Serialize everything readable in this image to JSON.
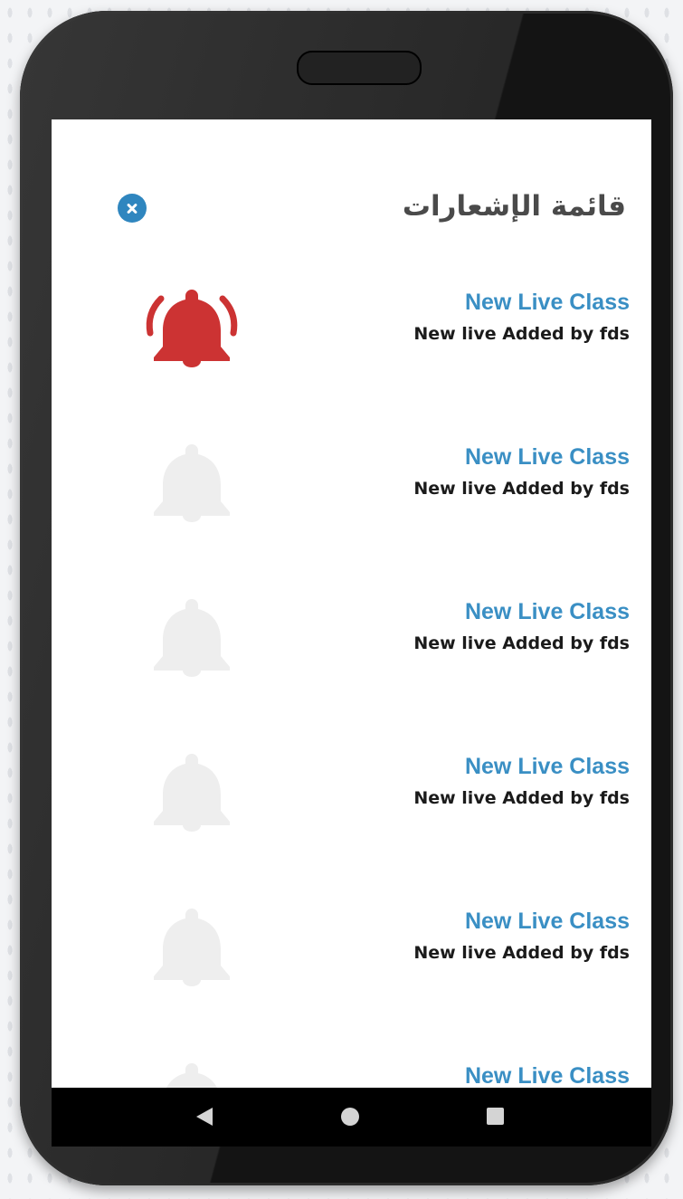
{
  "header": {
    "title": "قائمة الإشعارات"
  },
  "notifications": [
    {
      "title": "New Live Class",
      "subtitle": "New live Added by fds",
      "state": "unread"
    },
    {
      "title": "New Live Class",
      "subtitle": "New live Added by fds",
      "state": "read"
    },
    {
      "title": "New Live Class",
      "subtitle": "New live Added by fds",
      "state": "read"
    },
    {
      "title": "New Live Class",
      "subtitle": "New live Added by fds",
      "state": "read"
    },
    {
      "title": "New Live Class",
      "subtitle": "New live Added by fds",
      "state": "read"
    },
    {
      "title": "New Live Class",
      "state": "read"
    }
  ],
  "icons": {
    "close": "close-icon",
    "bell_unread": "bell-ringing-icon",
    "bell_read": "bell-icon"
  },
  "colors": {
    "accent_blue": "#3a8fc4",
    "close_blue": "#2f86bf",
    "bell_active": "#cc3333",
    "bell_inactive": "#eeeeee",
    "title_gray": "#4a4a4a"
  }
}
